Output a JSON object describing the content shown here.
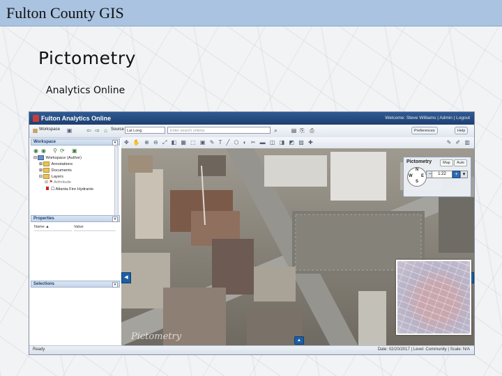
{
  "slide": {
    "header": "Fulton County GIS",
    "title": "Pictometry",
    "subtitle": "Analytics Online"
  },
  "app": {
    "title": "Fulton Analytics Online",
    "welcome": "Welcome: Steve Williams | Admin | Logout",
    "toolbar": {
      "workspace": "Workspace",
      "source_label": "Source",
      "source_value": "Lat Long",
      "search_placeholder": "Enter search criteria",
      "preferences": "Preferences",
      "help": "Help"
    },
    "panels": {
      "workspace": "Workspace",
      "properties": "Properties",
      "selections": "Selections"
    },
    "tree": [
      "Workspace (Author)",
      "Annotations",
      "Documents",
      "Layers",
      "Arthritude",
      "Atlanta Fire Hydrants"
    ],
    "properties_columns": [
      "Name",
      "Value"
    ],
    "pictometry_panel": {
      "title": "Pictometry",
      "tabs": [
        "Map",
        "Auto"
      ],
      "zoom": "1:22"
    },
    "status": {
      "left": "Ready",
      "right": "Date: 02/20/2017 | Level: Community | Scale: N/A"
    },
    "watermark": "Pictometry"
  },
  "colors": {
    "header_bar": "#a9c3e0",
    "app_header": "#1e3f6e",
    "accent_blue": "#1d5fa5"
  }
}
